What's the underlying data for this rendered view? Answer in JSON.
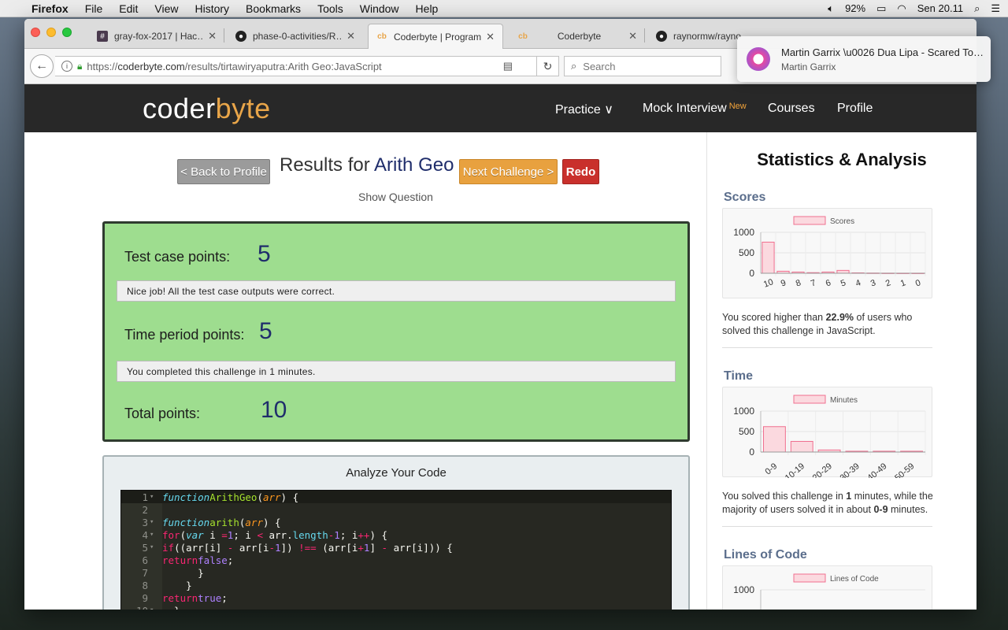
{
  "menubar": {
    "items": [
      "Firefox",
      "File",
      "Edit",
      "View",
      "History",
      "Bookmarks",
      "Tools",
      "Window",
      "Help"
    ],
    "battery": "92%",
    "clock": "Sen 20.11"
  },
  "tabs": [
    {
      "label": "gray-fox-2017 | Hac…",
      "favicon": "slack-icon"
    },
    {
      "label": "phase-0-activities/R…",
      "favicon": "github-icon"
    },
    {
      "label": "Coderbyte | Program…",
      "favicon": "coderbyte-icon"
    },
    {
      "label": "Coderbyte",
      "favicon": "coderbyte-icon"
    },
    {
      "label": "raynormw/rayno",
      "favicon": "github-icon"
    }
  ],
  "urlbar": {
    "url_prefix": "https://",
    "url_host": "coderbyte.com",
    "url_path": "/results/tirtawiryaputra:Arith Geo:JavaScript",
    "search_placeholder": "Search"
  },
  "notification": {
    "title": "Martin Garrix \\u0026 Dua Lipa - Scared To B…",
    "subtitle": "Martin Garrix"
  },
  "header": {
    "logo_a": "coder",
    "logo_b": "byte",
    "nav": {
      "practice": "Practice ∨",
      "mock": "Mock Interview",
      "mock_badge": "New",
      "courses": "Courses",
      "profile": "Profile"
    }
  },
  "results": {
    "back_label": "< Back to Profile",
    "title_prefix": "Results for",
    "challenge": "Arith Geo",
    "next_label": "Next Challenge >",
    "redo_label": "Redo",
    "show_question": "Show Question",
    "test_label": "Test case points:",
    "test_value": "5",
    "test_msg": "Nice job! All the test case outputs were correct.",
    "time_label": "Time period points:",
    "time_value": "5",
    "time_msg": "You completed this challenge in 1 minutes.",
    "total_label": "Total points:",
    "total_value": "10",
    "analyze_title": "Analyze Your Code"
  },
  "sidebar": {
    "title": "Statistics & Analysis",
    "scores_title": "Scores",
    "scores_text_a": "You scored higher than ",
    "scores_text_b": "22.9%",
    "scores_text_c": " of users who solved this challenge in JavaScript.",
    "time_title": "Time",
    "time_text_a": "You solved this challenge in ",
    "time_text_b": "1",
    "time_text_c": " minutes, while the majority of users solved it in about ",
    "time_text_d": "0-9",
    "time_text_e": " minutes.",
    "loc_title": "Lines of Code"
  },
  "chart_data": [
    {
      "type": "bar",
      "legend": "Scores",
      "categories": [
        "10",
        "9",
        "8",
        "7",
        "6",
        "5",
        "4",
        "3",
        "2",
        "1",
        "0"
      ],
      "values": [
        760,
        50,
        30,
        15,
        30,
        70,
        10,
        5,
        3,
        2,
        2
      ],
      "ylim": [
        0,
        1000
      ],
      "yticks": [
        "1000",
        "500",
        "0"
      ]
    },
    {
      "type": "bar",
      "legend": "Minutes",
      "categories": [
        "0-9",
        "10-19",
        "20-29",
        "30-39",
        "40-49",
        "50-59"
      ],
      "values": [
        620,
        260,
        50,
        20,
        20,
        20
      ],
      "ylim": [
        0,
        1000
      ],
      "yticks": [
        "1000",
        "500",
        "0"
      ]
    },
    {
      "type": "bar",
      "legend": "Lines of Code",
      "categories": [],
      "values": [],
      "ylim": [
        0,
        1000
      ],
      "yticks": [
        "1000"
      ]
    }
  ],
  "colors": {
    "bar_fill": "#fbd9df",
    "bar_stroke": "#f06f8f",
    "score_bg": "#9edd8f",
    "accent": "#e8a549"
  }
}
